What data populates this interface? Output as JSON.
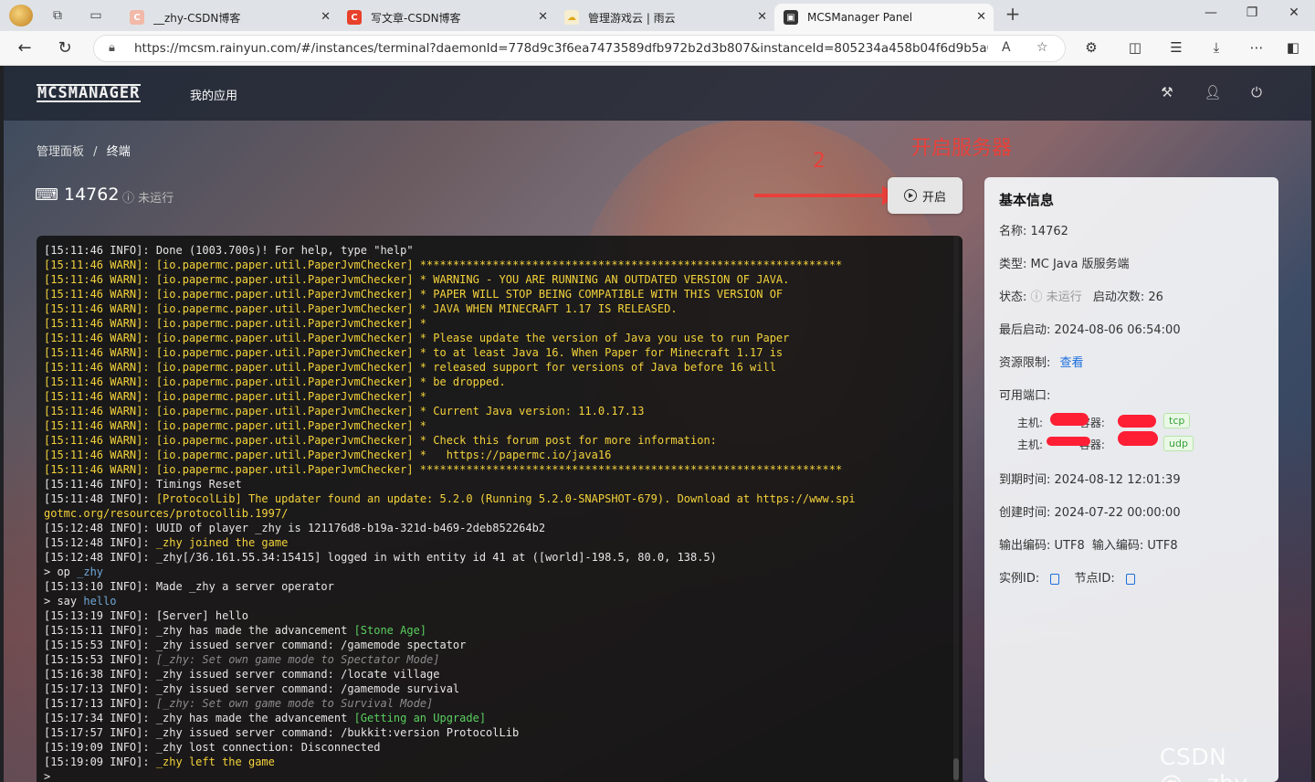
{
  "browser": {
    "tabs": [
      {
        "label": "__zhy-CSDN博客",
        "favicon": "C",
        "favicon_color": "#f2b8a8"
      },
      {
        "label": "写文章-CSDN博客",
        "favicon": "C",
        "favicon_color": "#e8402a"
      },
      {
        "label": "管理游戏云 | 雨云",
        "favicon": "☁",
        "favicon_color": "#f3d36a"
      },
      {
        "label": "MCSManager Panel",
        "favicon": "▣",
        "favicon_color": "#333333"
      }
    ],
    "new_tab": "+",
    "url": "https://mcsm.rainyun.com/#/instances/terminal?daemonId=778d9c3f6ea7473589dfb972b2d3b807&instanceId=805234a458b04f6d9b5a036ab361f937",
    "read_aloud": "A"
  },
  "app": {
    "logo": "MCSMANAGER",
    "nav_myapp": "我的应用",
    "breadcrumb": {
      "home": "管理面板",
      "sep": "/",
      "current": "终端"
    },
    "instance_name": "14762",
    "status": "未运行",
    "start_button": "开启",
    "annotation_text": "开启服务器",
    "annotation_number": "2"
  },
  "terminal": {
    "lines": [
      [
        {
          "t": "[15:11:46 INFO]: Done (1003.700s)! For help, type \"help\"",
          "c": ""
        }
      ],
      [
        {
          "t": "[15:11:46 WARN]: [io.papermc.paper.util.PaperJvmChecker] ****************************************************************",
          "c": "w"
        }
      ],
      [
        {
          "t": "[15:11:46 WARN]: [io.papermc.paper.util.PaperJvmChecker] * WARNING - YOU ARE RUNNING AN OUTDATED VERSION OF JAVA.",
          "c": "w"
        }
      ],
      [
        {
          "t": "[15:11:46 WARN]: [io.papermc.paper.util.PaperJvmChecker] * PAPER WILL STOP BEING COMPATIBLE WITH THIS VERSION OF",
          "c": "w"
        }
      ],
      [
        {
          "t": "[15:11:46 WARN]: [io.papermc.paper.util.PaperJvmChecker] * JAVA WHEN MINECRAFT 1.17 IS RELEASED.",
          "c": "w"
        }
      ],
      [
        {
          "t": "[15:11:46 WARN]: [io.papermc.paper.util.PaperJvmChecker] *",
          "c": "w"
        }
      ],
      [
        {
          "t": "[15:11:46 WARN]: [io.papermc.paper.util.PaperJvmChecker] * Please update the version of Java you use to run Paper",
          "c": "w"
        }
      ],
      [
        {
          "t": "[15:11:46 WARN]: [io.papermc.paper.util.PaperJvmChecker] * to at least Java 16. When Paper for Minecraft 1.17 is",
          "c": "w"
        }
      ],
      [
        {
          "t": "[15:11:46 WARN]: [io.papermc.paper.util.PaperJvmChecker] * released support for versions of Java before 16 will",
          "c": "w"
        }
      ],
      [
        {
          "t": "[15:11:46 WARN]: [io.papermc.paper.util.PaperJvmChecker] * be dropped.",
          "c": "w"
        }
      ],
      [
        {
          "t": "[15:11:46 WARN]: [io.papermc.paper.util.PaperJvmChecker] *",
          "c": "w"
        }
      ],
      [
        {
          "t": "[15:11:46 WARN]: [io.papermc.paper.util.PaperJvmChecker] * Current Java version: 11.0.17.13",
          "c": "w"
        }
      ],
      [
        {
          "t": "[15:11:46 WARN]: [io.papermc.paper.util.PaperJvmChecker] *",
          "c": "w"
        }
      ],
      [
        {
          "t": "[15:11:46 WARN]: [io.papermc.paper.util.PaperJvmChecker] * Check this forum post for more information:",
          "c": "w"
        }
      ],
      [
        {
          "t": "[15:11:46 WARN]: [io.papermc.paper.util.PaperJvmChecker] *   https://papermc.io/java16",
          "c": "w"
        }
      ],
      [
        {
          "t": "[15:11:46 WARN]: [io.papermc.paper.util.PaperJvmChecker] ****************************************************************",
          "c": "w"
        }
      ],
      [
        {
          "t": "[15:11:46 INFO]: Timings Reset",
          "c": ""
        }
      ],
      [
        {
          "t": "[15:11:48 INFO]: ",
          "c": ""
        },
        {
          "t": "[ProtocolLib] The updater found an update: 5.2.0 (Running 5.2.0-SNAPSHOT-679). Download at https://www.spi",
          "c": "w"
        }
      ],
      [
        {
          "t": "gotmc.org/resources/protocollib.1997/",
          "c": "w"
        }
      ],
      [
        {
          "t": "[15:12:48 INFO]: UUID of player _zhy is 121176d8-b19a-321d-b469-2deb852264b2",
          "c": ""
        }
      ],
      [
        {
          "t": "[15:12:48 INFO]: ",
          "c": ""
        },
        {
          "t": "_zhy joined the game",
          "c": "w"
        }
      ],
      [
        {
          "t": "[15:12:48 INFO]: _zhy[/36.161.55.34:15415] logged in with entity id 41 at ([world]-198.5, 80.0, 138.5)",
          "c": ""
        }
      ],
      [
        {
          "t": "> op ",
          "c": ""
        },
        {
          "t": "_zhy",
          "c": "c"
        }
      ],
      [
        {
          "t": "[15:13:10 INFO]: Made _zhy a server operator",
          "c": ""
        }
      ],
      [
        {
          "t": "> say ",
          "c": ""
        },
        {
          "t": "hello",
          "c": "c"
        }
      ],
      [
        {
          "t": "[15:13:19 INFO]: [Server] hello",
          "c": ""
        }
      ],
      [
        {
          "t": "[15:15:11 INFO]: _zhy has made the advancement ",
          "c": ""
        },
        {
          "t": "[Stone Age]",
          "c": "g"
        }
      ],
      [
        {
          "t": "[15:15:53 INFO]: _zhy issued server command: /gamemode spectator",
          "c": ""
        }
      ],
      [
        {
          "t": "[15:15:53 INFO]: ",
          "c": ""
        },
        {
          "t": "[_zhy: Set own game mode to Spectator Mode]",
          "c": "i"
        }
      ],
      [
        {
          "t": "[15:16:38 INFO]: _zhy issued server command: /locate village",
          "c": ""
        }
      ],
      [
        {
          "t": "[15:17:13 INFO]: _zhy issued server command: /gamemode survival",
          "c": ""
        }
      ],
      [
        {
          "t": "[15:17:13 INFO]: ",
          "c": ""
        },
        {
          "t": "[_zhy: Set own game mode to Survival Mode]",
          "c": "i"
        }
      ],
      [
        {
          "t": "[15:17:34 INFO]: _zhy has made the advancement ",
          "c": ""
        },
        {
          "t": "[Getting an Upgrade]",
          "c": "g"
        }
      ],
      [
        {
          "t": "[15:17:57 INFO]: _zhy issued server command: /bukkit:version ProtocolLib",
          "c": ""
        }
      ],
      [
        {
          "t": "[15:19:09 INFO]: _zhy lost connection: Disconnected",
          "c": ""
        }
      ],
      [
        {
          "t": "[15:19:09 INFO]: ",
          "c": ""
        },
        {
          "t": "_zhy left the game",
          "c": "w"
        }
      ],
      [
        {
          "t": ">",
          "c": ""
        }
      ]
    ]
  },
  "info": {
    "title": "基本信息",
    "name_label": "名称:",
    "name_value": "14762",
    "type_label": "类型:",
    "type_value": "MC Java 版服务端",
    "state_label": "状态:",
    "state_value": "未运行",
    "starts_label": "启动次数:",
    "starts_value": "26",
    "last_start_label": "最后启动:",
    "last_start_value": "2024-08-06 06:54:00",
    "resource_label": "资源限制:",
    "resource_link": "查看",
    "ports_label": "可用端口:",
    "ports": [
      {
        "host": "主机:",
        "container": "容器:",
        "protocol": "tcp"
      },
      {
        "host": "主机:",
        "container": "容器:",
        "protocol": "udp"
      }
    ],
    "expire_label": "到期时间:",
    "expire_value": "2024-08-12 12:01:39",
    "created_label": "创建时间:",
    "created_value": "2024-07-22 00:00:00",
    "encoding_label": "输出编码:",
    "encoding_value": "UTF8",
    "input_encoding_label": "输入编码:",
    "input_encoding_value": "UTF8",
    "instance_id_label": "实例ID:",
    "node_id_label": "节点ID:"
  },
  "watermark": "CSDN @__zhy"
}
